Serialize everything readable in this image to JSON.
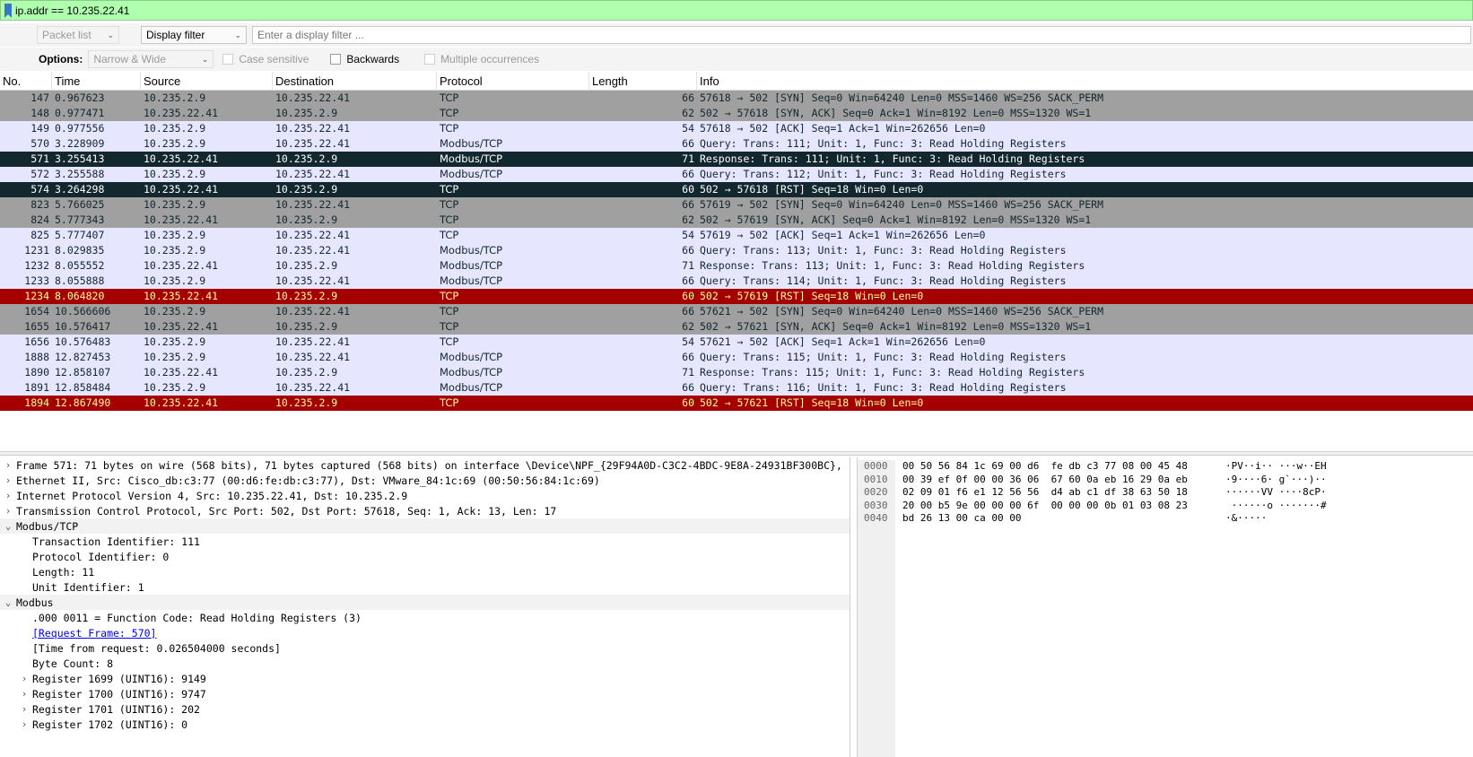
{
  "display_filter": {
    "value": "ip.addr == 10.235.22.41"
  },
  "find_toolbar": {
    "search_in": "Packet list",
    "search_type": "Display filter",
    "filter_placeholder": "Enter a display filter ..."
  },
  "options": {
    "label": "Options:",
    "char_width": "Narrow & Wide",
    "case_sensitive": "Case sensitive",
    "backwards": "Backwards",
    "multiple_occurrences": "Multiple occurrences"
  },
  "columns": [
    "No.",
    "Time",
    "Source",
    "Destination",
    "Protocol",
    "Length",
    "Info"
  ],
  "colors": {
    "gray_row": "#a0a0a0",
    "lavender_row": "#e7e6ff",
    "selected_row": "#12272e",
    "rst_row": "#a40000",
    "filter_ok": "#afffaf"
  },
  "packets": [
    {
      "no": "147",
      "time": "0.967623",
      "src": "10.235.2.9",
      "dst": "10.235.22.41",
      "proto": "TCP",
      "len": "66",
      "info": "57618 → 502 [SYN] Seq=0 Win=64240 Len=0 MSS=1460 WS=256 SACK_PERM",
      "style": "gray"
    },
    {
      "no": "148",
      "time": "0.977471",
      "src": "10.235.22.41",
      "dst": "10.235.2.9",
      "proto": "TCP",
      "len": "62",
      "info": "502 → 57618 [SYN, ACK] Seq=0 Ack=1 Win=8192 Len=0 MSS=1320 WS=1",
      "style": "gray"
    },
    {
      "no": "149",
      "time": "0.977556",
      "src": "10.235.2.9",
      "dst": "10.235.22.41",
      "proto": "TCP",
      "len": "54",
      "info": "57618 → 502 [ACK] Seq=1 Ack=1 Win=262656 Len=0",
      "style": "lavender"
    },
    {
      "no": "570",
      "time": "3.228909",
      "src": "10.235.2.9",
      "dst": "10.235.22.41",
      "proto": "Modbus/TCP",
      "len": "66",
      "info": "  Query: Trans:   111; Unit:   1, Func:   3: Read Holding Registers",
      "style": "lavender"
    },
    {
      "no": "571",
      "time": "3.255413",
      "src": "10.235.22.41",
      "dst": "10.235.2.9",
      "proto": "Modbus/TCP",
      "len": "71",
      "info": "Response: Trans:   111; Unit:   1, Func:   3: Read Holding Registers",
      "style": "selected"
    },
    {
      "no": "572",
      "time": "3.255588",
      "src": "10.235.2.9",
      "dst": "10.235.22.41",
      "proto": "Modbus/TCP",
      "len": "66",
      "info": "  Query: Trans:   112; Unit:   1, Func:   3: Read Holding Registers",
      "style": "lavender"
    },
    {
      "no": "574",
      "time": "3.264298",
      "src": "10.235.22.41",
      "dst": "10.235.2.9",
      "proto": "TCP",
      "len": "60",
      "info": "502 → 57618 [RST] Seq=18 Win=0 Len=0",
      "style": "selected"
    },
    {
      "no": "823",
      "time": "5.766025",
      "src": "10.235.2.9",
      "dst": "10.235.22.41",
      "proto": "TCP",
      "len": "66",
      "info": "57619 → 502 [SYN] Seq=0 Win=64240 Len=0 MSS=1460 WS=256 SACK_PERM",
      "style": "gray"
    },
    {
      "no": "824",
      "time": "5.777343",
      "src": "10.235.22.41",
      "dst": "10.235.2.9",
      "proto": "TCP",
      "len": "62",
      "info": "502 → 57619 [SYN, ACK] Seq=0 Ack=1 Win=8192 Len=0 MSS=1320 WS=1",
      "style": "gray"
    },
    {
      "no": "825",
      "time": "5.777407",
      "src": "10.235.2.9",
      "dst": "10.235.22.41",
      "proto": "TCP",
      "len": "54",
      "info": "57619 → 502 [ACK] Seq=1 Ack=1 Win=262656 Len=0",
      "style": "lavender"
    },
    {
      "no": "1231",
      "time": "8.029835",
      "src": "10.235.2.9",
      "dst": "10.235.22.41",
      "proto": "Modbus/TCP",
      "len": "66",
      "info": "  Query: Trans:   113; Unit:   1, Func:   3: Read Holding Registers",
      "style": "lavender"
    },
    {
      "no": "1232",
      "time": "8.055552",
      "src": "10.235.22.41",
      "dst": "10.235.2.9",
      "proto": "Modbus/TCP",
      "len": "71",
      "info": "Response: Trans:   113; Unit:   1, Func:   3: Read Holding Registers",
      "style": "lavender"
    },
    {
      "no": "1233",
      "time": "8.055888",
      "src": "10.235.2.9",
      "dst": "10.235.22.41",
      "proto": "Modbus/TCP",
      "len": "66",
      "info": "  Query: Trans:   114; Unit:   1, Func:   3: Read Holding Registers",
      "style": "lavender"
    },
    {
      "no": "1234",
      "time": "8.064820",
      "src": "10.235.22.41",
      "dst": "10.235.2.9",
      "proto": "TCP",
      "len": "60",
      "info": "502 → 57619 [RST] Seq=18 Win=0 Len=0",
      "style": "rst"
    },
    {
      "no": "1654",
      "time": "10.566606",
      "src": "10.235.2.9",
      "dst": "10.235.22.41",
      "proto": "TCP",
      "len": "66",
      "info": "57621 → 502 [SYN] Seq=0 Win=64240 Len=0 MSS=1460 WS=256 SACK_PERM",
      "style": "gray"
    },
    {
      "no": "1655",
      "time": "10.576417",
      "src": "10.235.22.41",
      "dst": "10.235.2.9",
      "proto": "TCP",
      "len": "62",
      "info": "502 → 57621 [SYN, ACK] Seq=0 Ack=1 Win=8192 Len=0 MSS=1320 WS=1",
      "style": "gray"
    },
    {
      "no": "1656",
      "time": "10.576483",
      "src": "10.235.2.9",
      "dst": "10.235.22.41",
      "proto": "TCP",
      "len": "54",
      "info": "57621 → 502 [ACK] Seq=1 Ack=1 Win=262656 Len=0",
      "style": "lavender"
    },
    {
      "no": "1888",
      "time": "12.827453",
      "src": "10.235.2.9",
      "dst": "10.235.22.41",
      "proto": "Modbus/TCP",
      "len": "66",
      "info": "  Query: Trans:   115; Unit:   1, Func:   3: Read Holding Registers",
      "style": "lavender"
    },
    {
      "no": "1890",
      "time": "12.858107",
      "src": "10.235.22.41",
      "dst": "10.235.2.9",
      "proto": "Modbus/TCP",
      "len": "71",
      "info": "Response: Trans:   115; Unit:   1, Func:   3: Read Holding Registers",
      "style": "lavender"
    },
    {
      "no": "1891",
      "time": "12.858484",
      "src": "10.235.2.9",
      "dst": "10.235.22.41",
      "proto": "Modbus/TCP",
      "len": "66",
      "info": "  Query: Trans:   116; Unit:   1, Func:   3: Read Holding Registers",
      "style": "lavender"
    },
    {
      "no": "1894",
      "time": "12.867490",
      "src": "10.235.22.41",
      "dst": "10.235.2.9",
      "proto": "TCP",
      "len": "60",
      "info": "502 → 57621 [RST] Seq=18 Win=0 Len=0",
      "style": "rst"
    }
  ],
  "details": [
    {
      "text": "Frame 571: 71 bytes on wire (568 bits), 71 bytes captured (568 bits) on interface \\Device\\NPF_{29F94A0D-C3C2-4BDC-9E8A-24931BF300BC},",
      "level": 0,
      "exp": "›"
    },
    {
      "text": "Ethernet II, Src: Cisco_db:c3:77 (00:d6:fe:db:c3:77), Dst: VMware_84:1c:69 (00:50:56:84:1c:69)",
      "level": 0,
      "exp": "›"
    },
    {
      "text": "Internet Protocol Version 4, Src: 10.235.22.41, Dst: 10.235.2.9",
      "level": 0,
      "exp": "›"
    },
    {
      "text": "Transmission Control Protocol, Src Port: 502, Dst Port: 57618, Seq: 1, Ack: 13, Len: 17",
      "level": 0,
      "exp": "›"
    },
    {
      "text": "Modbus/TCP",
      "level": 0,
      "exp": "⌄",
      "shaded": true
    },
    {
      "text": "Transaction Identifier: 111",
      "level": 1,
      "exp": ""
    },
    {
      "text": "Protocol Identifier: 0",
      "level": 1,
      "exp": ""
    },
    {
      "text": "Length: 11",
      "level": 1,
      "exp": ""
    },
    {
      "text": "Unit Identifier: 1",
      "level": 1,
      "exp": ""
    },
    {
      "text": "Modbus",
      "level": 0,
      "exp": "⌄",
      "shaded": true
    },
    {
      "text": ".000 0011 = Function Code: Read Holding Registers (3)",
      "level": 1,
      "exp": ""
    },
    {
      "text": "[Request Frame: 570]",
      "level": 1,
      "exp": "",
      "link": true
    },
    {
      "text": "[Time from request: 0.026504000 seconds]",
      "level": 1,
      "exp": ""
    },
    {
      "text": "Byte Count: 8",
      "level": 1,
      "exp": ""
    },
    {
      "text": "Register 1699 (UINT16): 9149",
      "level": 1,
      "exp": "›"
    },
    {
      "text": "Register 1700 (UINT16): 9747",
      "level": 1,
      "exp": "›"
    },
    {
      "text": "Register 1701 (UINT16): 202",
      "level": 1,
      "exp": "›"
    },
    {
      "text": "Register 1702 (UINT16): 0",
      "level": 1,
      "exp": "›"
    }
  ],
  "bytes": [
    {
      "off": "0000",
      "hex": "00 50 56 84 1c 69 00 d6  fe db c3 77 08 00 45 48",
      "ascii": "·PV··i·· ···w··EH"
    },
    {
      "off": "0010",
      "hex": "00 39 ef 0f 00 00 36 06  67 60 0a eb 16 29 0a eb",
      "ascii": "·9····6· g`···)··"
    },
    {
      "off": "0020",
      "hex": "02 09 01 f6 e1 12 56 56  d4 ab c1 df 38 63 50 18",
      "ascii": "······VV ····8cP·"
    },
    {
      "off": "0030",
      "hex": "20 00 b5 9e 00 00 00 6f  00 00 00 0b 01 03 08 23",
      "ascii": " ······o ·······#"
    },
    {
      "off": "0040",
      "hex": "bd 26 13 00 ca 00 00",
      "ascii": "·&·····"
    }
  ]
}
